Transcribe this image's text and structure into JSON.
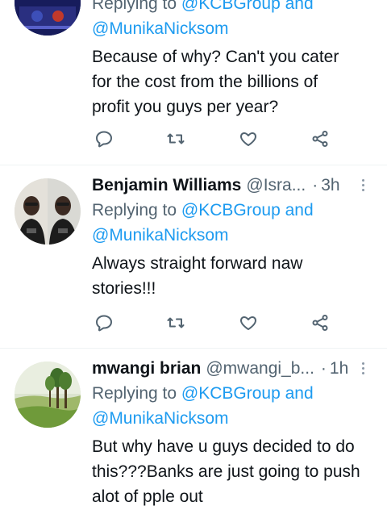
{
  "tweets": [
    {
      "name": "",
      "handle": "",
      "time": "",
      "replying_prefix": "Replying to ",
      "replying_to": "@KCBGroup and",
      "mention2": "@MunikaNicksom",
      "text_lines": [
        "Because of why? Can't you cater",
        "for the cost from the billions of",
        "profit you guys per year?"
      ]
    },
    {
      "name": "Benjamin Williams",
      "handle": "@Isra...",
      "time": "3h",
      "replying_prefix": "Replying to ",
      "replying_to": "@KCBGroup and",
      "mention2": "@MunikaNicksom",
      "text_lines": [
        "Always straight forward naw",
        "stories!!!"
      ]
    },
    {
      "name": "mwangi brian",
      "handle": "@mwangi_b...",
      "time": "1h",
      "replying_prefix": "Replying to ",
      "replying_to": "@KCBGroup and",
      "mention2": "@MunikaNicksom",
      "text_lines": [
        "But why have u guys decided to do",
        "this???Banks are just going to push",
        "alot of pple out"
      ]
    }
  ],
  "separator": "·",
  "icons": {
    "reply": "reply-icon",
    "retweet": "retweet-icon",
    "like": "like-icon",
    "share": "share-icon",
    "more": "more-options-icon"
  },
  "colors": {
    "link": "#1d9bf0",
    "muted": "#536471",
    "text": "#0f1419",
    "divider": "#eff3f4"
  }
}
